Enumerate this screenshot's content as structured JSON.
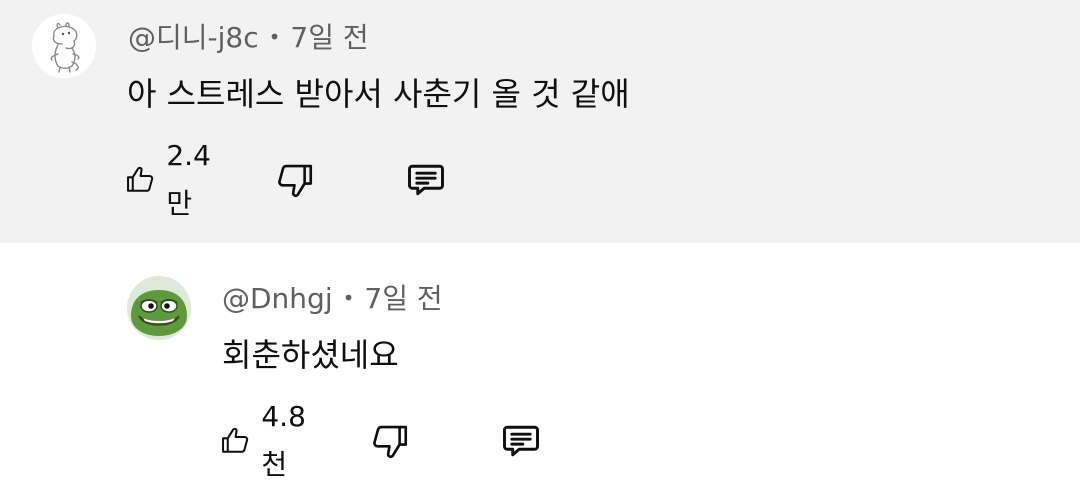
{
  "comments": [
    {
      "handle": "@디니-j8c",
      "separator": "•",
      "time": "7일 전",
      "text": "아 스트레스 받아서 사춘기 올 것 같애",
      "likes": "2.4만",
      "avatar_icon": "moomin-avatar-icon"
    },
    {
      "handle": "@Dnhgj",
      "separator": "•",
      "time": "7일 전",
      "text": "회춘하셨네요",
      "likes": "4.8천",
      "avatar_icon": "pepe-frog-avatar-icon"
    }
  ],
  "colors": {
    "highlight_bg": "#f2f2f2",
    "meta_text": "#606060",
    "body_text": "#0f0f0f"
  },
  "icons": {
    "like": "thumbs-up-icon",
    "dislike": "thumbs-down-icon",
    "reply": "comment-reply-icon"
  }
}
